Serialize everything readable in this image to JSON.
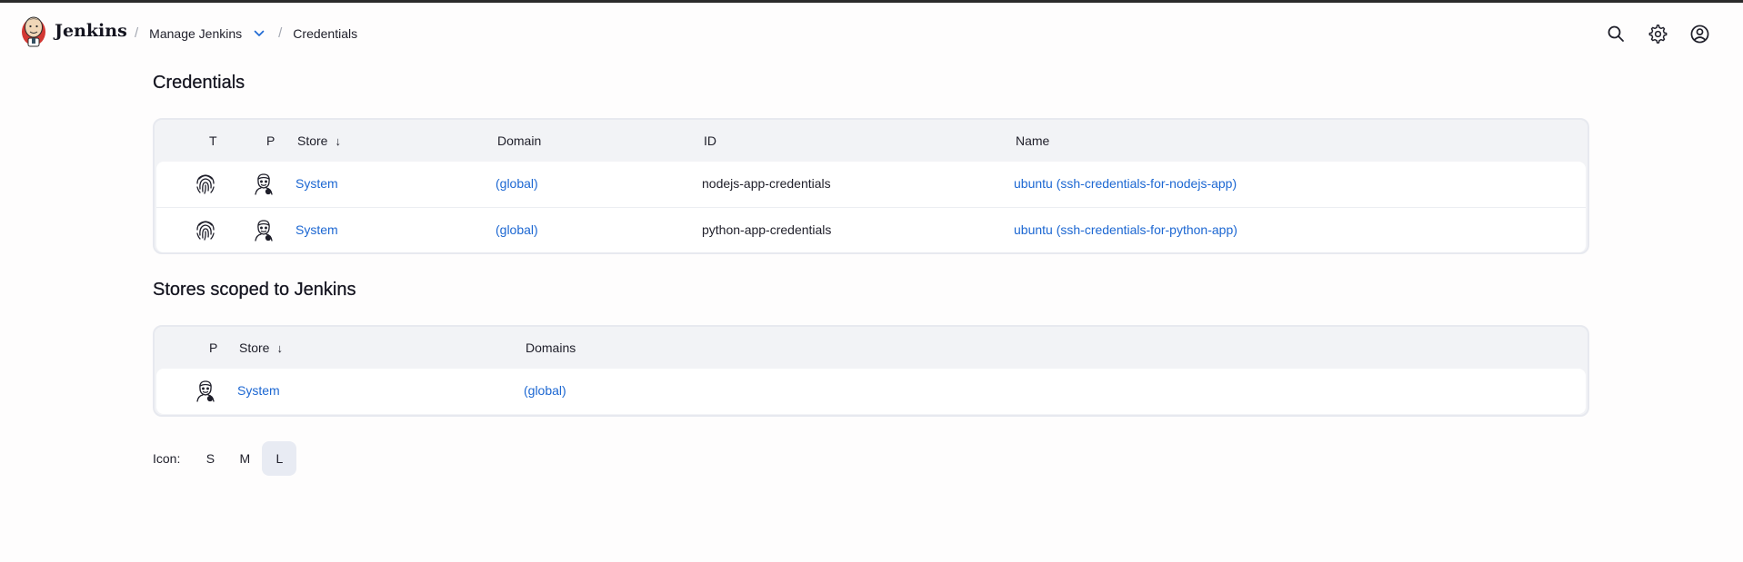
{
  "header": {
    "brand": "Jenkins",
    "breadcrumbs": [
      {
        "label": "Manage Jenkins",
        "has_dropdown": true
      },
      {
        "label": "Credentials",
        "has_dropdown": false
      }
    ],
    "actions": [
      "search-icon",
      "gear-icon",
      "user-icon"
    ]
  },
  "credentials": {
    "title": "Credentials",
    "columns": {
      "t": "T",
      "p": "P",
      "store": "Store",
      "sort_arrow": "↓",
      "domain": "Domain",
      "id": "ID",
      "name": "Name"
    },
    "rows": [
      {
        "type_icon": "fingerprint-icon",
        "provider_icon": "jenkins-head-icon",
        "store": "System",
        "domain": "(global)",
        "id": "nodejs-app-credentials",
        "name": "ubuntu (ssh-credentials-for-nodejs-app)"
      },
      {
        "type_icon": "fingerprint-icon",
        "provider_icon": "jenkins-head-icon",
        "store": "System",
        "domain": "(global)",
        "id": "python-app-credentials",
        "name": "ubuntu (ssh-credentials-for-python-app)"
      }
    ]
  },
  "stores": {
    "title": "Stores scoped to Jenkins",
    "columns": {
      "p": "P",
      "store": "Store",
      "sort_arrow": "↓",
      "domains": "Domains"
    },
    "rows": [
      {
        "provider_icon": "jenkins-head-icon",
        "store": "System",
        "domains": "(global)"
      }
    ]
  },
  "icon_size": {
    "label": "Icon:",
    "options": [
      "S",
      "M",
      "L"
    ],
    "selected": "L"
  },
  "colors": {
    "link": "#1c67d2",
    "card_bg": "#f2f3f6",
    "selected_bg": "#e8ebf3"
  }
}
